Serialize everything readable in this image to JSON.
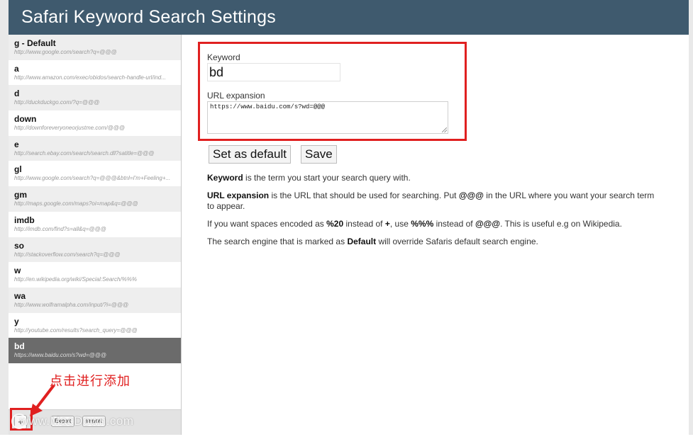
{
  "header": {
    "title": "Safari Keyword Search Settings"
  },
  "keywords": [
    {
      "keyword": "g - Default",
      "url": "http://www.google.com/search?q=@@@"
    },
    {
      "keyword": "a",
      "url": "http://www.amazon.com/exec/obidos/search-handle-url/ind..."
    },
    {
      "keyword": "d",
      "url": "http://duckduckgo.com/?q=@@@"
    },
    {
      "keyword": "down",
      "url": "http://downforeveryoneorjustme.com/@@@"
    },
    {
      "keyword": "e",
      "url": "http://search.ebay.com/search/search.dll?satitle=@@@"
    },
    {
      "keyword": "gl",
      "url": "http://www.google.com/search?q=@@@&btnl=I'm+Feeling+..."
    },
    {
      "keyword": "gm",
      "url": "http://maps.google.com/maps?oi=map&q=@@@"
    },
    {
      "keyword": "imdb",
      "url": "http://imdb.com/find?s=all&q=@@@"
    },
    {
      "keyword": "so",
      "url": "http://stackoverflow.com/search?q=@@@"
    },
    {
      "keyword": "w",
      "url": "http://en.wikipedia.org/wiki/Special:Search/%%%"
    },
    {
      "keyword": "wa",
      "url": "http://www.wolframalpha.com/input/?i=@@@"
    },
    {
      "keyword": "y",
      "url": "http://youtube.com/results?search_query=@@@"
    },
    {
      "keyword": "bd",
      "url": "https://www.baidu.com/s?wd=@@@"
    }
  ],
  "selected_index": 12,
  "footer": {
    "add_label": "+",
    "export_label": "Export",
    "import_label": "Import"
  },
  "form": {
    "keyword_label": "Keyword",
    "keyword_value": "bd",
    "url_label": "URL expansion",
    "url_value": "https://www.baidu.com/s?wd=@@@",
    "set_default_label": "Set as default",
    "save_label": "Save"
  },
  "help": {
    "p1_strong": "Keyword",
    "p1_rest": " is the term you start your search query with.",
    "p2_strong1": "URL expansion",
    "p2_mid": " is the URL that should be used for searching. Put ",
    "p2_strong2": "@@@",
    "p2_rest": " in the URL where you want your search term to appear.",
    "p3_a": "If you want spaces encoded as ",
    "p3_strong1": "%20",
    "p3_b": " instead of ",
    "p3_strong2": "+",
    "p3_c": ", use ",
    "p3_strong3": "%%%",
    "p3_d": " instead of ",
    "p3_strong4": "@@@",
    "p3_e": ". This is useful e.g on Wikipedia.",
    "p4_a": "The search engine that is marked as ",
    "p4_strong": "Default",
    "p4_b": " will override Safaris default search engine."
  },
  "annotation": {
    "label": "点击进行添加",
    "color": "#e02020"
  },
  "watermark": {
    "text": "www.MacDown.com"
  },
  "colors": {
    "header_bg": "#3f5a6e",
    "selected_row": "#6b6b6b"
  }
}
